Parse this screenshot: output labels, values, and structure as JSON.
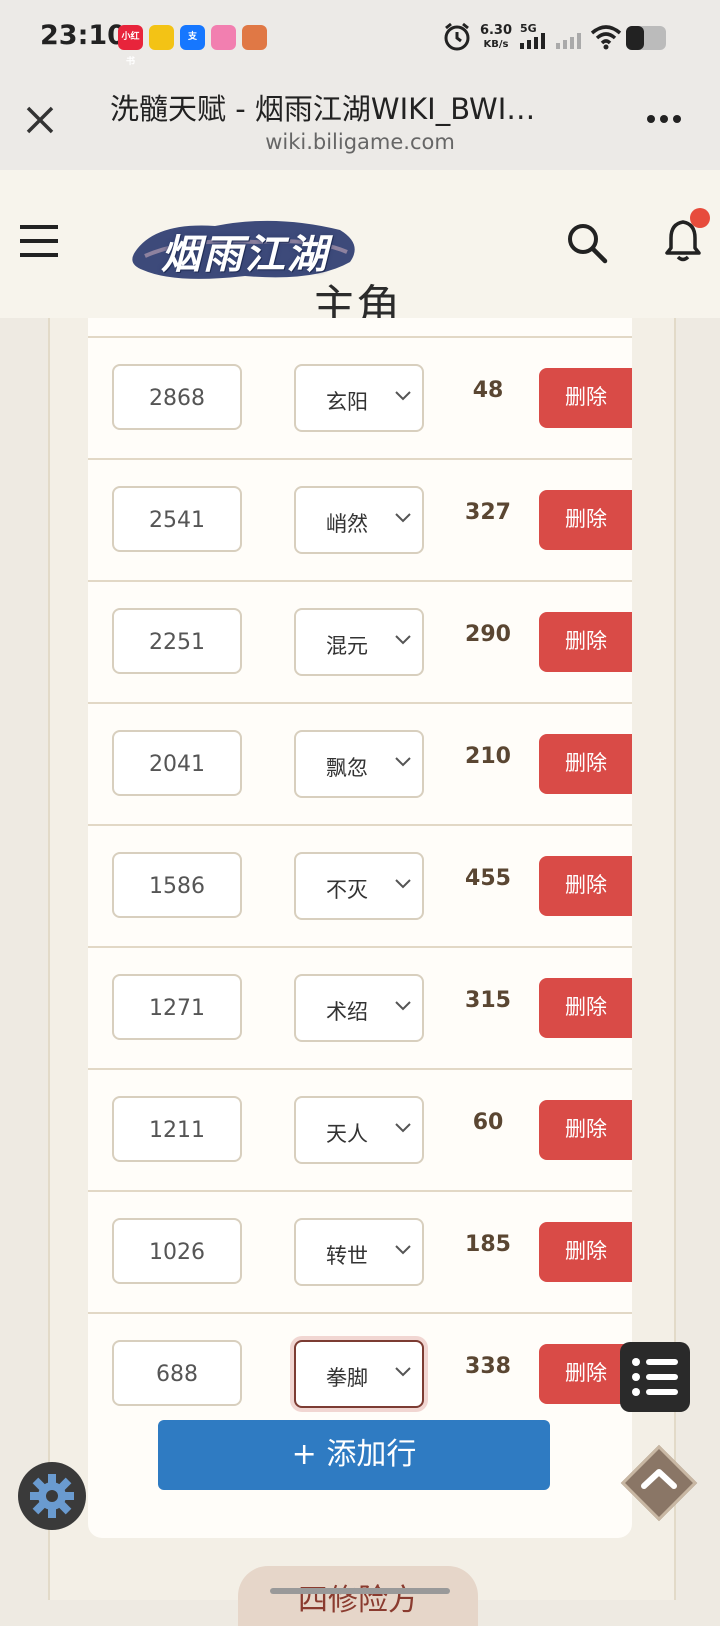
{
  "status_bar": {
    "time": "23:10",
    "app_icons": [
      {
        "name": "xiaohongshu-icon",
        "label": "小红书",
        "color": "#e8243b"
      },
      {
        "name": "app-yellow-icon",
        "label": "",
        "color": "#f3c315"
      },
      {
        "name": "alipay-icon",
        "label": "支",
        "color": "#1677ff"
      },
      {
        "name": "flower-app-icon",
        "label": "",
        "color": "#f27fb0"
      },
      {
        "name": "game-app-icon",
        "label": "",
        "color": "#e07845"
      }
    ],
    "speed": "6.30",
    "speed_unit": "KB/s",
    "network": "5G"
  },
  "browser": {
    "title": "洗髓天赋 - 烟雨江湖WIKI_BWI…",
    "url": "wiki.biligame.com"
  },
  "site": {
    "logo_text": "烟雨江湖",
    "section_heading": "主角"
  },
  "rows": [
    {
      "number": "2868",
      "type": "玄阳",
      "value": "48",
      "delete_label": "删除"
    },
    {
      "number": "2541",
      "type": "峭然",
      "value": "327",
      "delete_label": "删除"
    },
    {
      "number": "2251",
      "type": "混元",
      "value": "290",
      "delete_label": "删除"
    },
    {
      "number": "2041",
      "type": "飘忽",
      "value": "210",
      "delete_label": "删除"
    },
    {
      "number": "1586",
      "type": "不灭",
      "value": "455",
      "delete_label": "删除"
    },
    {
      "number": "1271",
      "type": "术绍",
      "value": "315",
      "delete_label": "删除"
    },
    {
      "number": "1211",
      "type": "天人",
      "value": "60",
      "delete_label": "删除"
    },
    {
      "number": "1026",
      "type": "转世",
      "value": "185",
      "delete_label": "删除"
    },
    {
      "number": "688",
      "type": "拳脚",
      "value": "338",
      "delete_label": "删除",
      "focused": true
    }
  ],
  "add_row_label": "+ 添加行",
  "bottom_tab_label": "四修险方",
  "colors": {
    "delete": "#d94b47",
    "add": "#2f7bc2",
    "background": "#eeeae2"
  }
}
